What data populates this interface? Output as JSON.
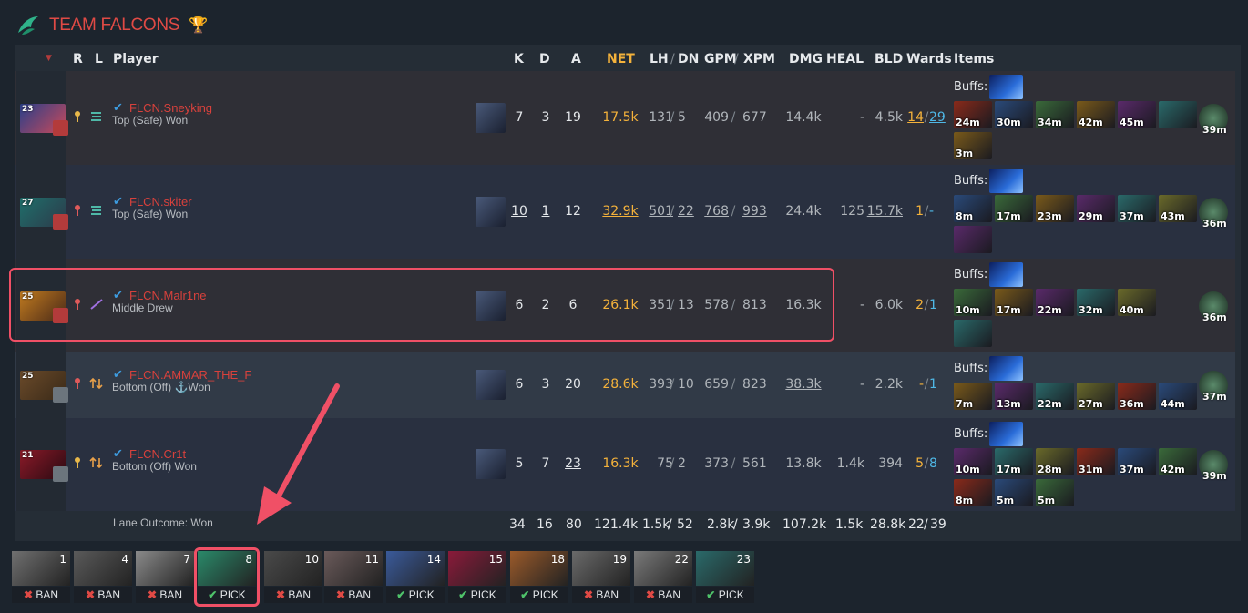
{
  "team": {
    "name": "TEAM FALCONS",
    "trophy_icon": "trophy-icon",
    "logo_icon": "falcon-logo-icon"
  },
  "columns": {
    "r": "R",
    "l": "L",
    "player": "Player",
    "k": "K",
    "d": "D",
    "a": "A",
    "net": "NET",
    "lh": "LH",
    "dn": "DN",
    "gpm": "GPM",
    "xpm": "XPM",
    "dmg": "DMG",
    "heal": "HEAL",
    "bld": "BLD",
    "wards": "Wards",
    "items": "Items",
    "sep": "/"
  },
  "buffs_label": "Buffs:",
  "players": [
    {
      "level": "23",
      "name": "FLCN.Sneyking",
      "lane": "Top (Safe) Won",
      "k": "7",
      "d": "3",
      "a": "19",
      "net": "17.5k",
      "lh": "131",
      "dn": "5",
      "gpm": "409",
      "xpm": "677",
      "dmg": "14.4k",
      "heal": "-",
      "bld": "4.5k",
      "wards_obs": "14",
      "wards_sen": "29",
      "items": [
        "24m",
        "30m",
        "34m",
        "42m",
        "45m",
        ""
      ],
      "items2": [
        "3m"
      ],
      "neutral": "39m"
    },
    {
      "level": "27",
      "name": "FLCN.skiter",
      "lane": "Top (Safe) Won",
      "k": "10",
      "d": "1",
      "a": "12",
      "net": "32.9k",
      "lh": "501",
      "dn": "22",
      "gpm": "768",
      "xpm": "993",
      "dmg": "24.4k",
      "heal": "125",
      "bld": "15.7k",
      "wards_obs": "1",
      "wards_sen": "-",
      "items": [
        "8m",
        "17m",
        "23m",
        "29m",
        "37m",
        "43m"
      ],
      "items2": [
        ""
      ],
      "neutral": "36m"
    },
    {
      "level": "25",
      "name": "FLCN.Malr1ne",
      "lane": "Middle Drew",
      "k": "6",
      "d": "2",
      "a": "6",
      "net": "26.1k",
      "lh": "351",
      "dn": "13",
      "gpm": "578",
      "xpm": "813",
      "dmg": "16.3k",
      "heal": "-",
      "bld": "6.0k",
      "wards_obs": "2",
      "wards_sen": "1",
      "items": [
        "10m",
        "17m",
        "22m",
        "32m",
        "40m"
      ],
      "items2": [
        ""
      ],
      "neutral": "36m"
    },
    {
      "level": "25",
      "name": "FLCN.AMMAR_THE_F",
      "lane": "Bottom (Off) ⚓Won",
      "k": "6",
      "d": "3",
      "a": "20",
      "net": "28.6k",
      "lh": "393",
      "dn": "10",
      "gpm": "659",
      "xpm": "823",
      "dmg": "38.3k",
      "heal": "-",
      "bld": "2.2k",
      "wards_obs": "-",
      "wards_sen": "1",
      "items": [
        "7m",
        "13m",
        "22m",
        "27m",
        "36m",
        "44m"
      ],
      "items2": [],
      "neutral": "37m"
    },
    {
      "level": "21",
      "name": "FLCN.Cr1t-",
      "lane": "Bottom (Off) Won",
      "k": "5",
      "d": "7",
      "a": "23",
      "net": "16.3k",
      "lh": "75",
      "dn": "2",
      "gpm": "373",
      "xpm": "561",
      "dmg": "13.8k",
      "heal": "1.4k",
      "bld": "394",
      "wards_obs": "5",
      "wards_sen": "8",
      "items": [
        "10m",
        "17m",
        "28m",
        "31m",
        "37m",
        "42m"
      ],
      "items2": [
        "8m",
        "5m",
        "5m"
      ],
      "neutral": "39m"
    }
  ],
  "totals": {
    "label": "Lane Outcome: Won",
    "k": "34",
    "d": "16",
    "a": "80",
    "net": "121.4k",
    "lh": "1.5k",
    "dn": "52",
    "gpm": "2.8k",
    "xpm": "3.9k",
    "dmg": "107.2k",
    "heal": "1.5k",
    "bld": "28.8k",
    "wards_obs": "22",
    "wards_sen": "39"
  },
  "draft": [
    {
      "order": "1",
      "action": "BAN"
    },
    {
      "order": "4",
      "action": "BAN"
    },
    {
      "order": "7",
      "action": "BAN"
    },
    {
      "order": "8",
      "action": "PICK"
    },
    {
      "order": "10",
      "action": "BAN"
    },
    {
      "order": "11",
      "action": "BAN"
    },
    {
      "order": "14",
      "action": "PICK"
    },
    {
      "order": "15",
      "action": "PICK"
    },
    {
      "order": "18",
      "action": "PICK"
    },
    {
      "order": "19",
      "action": "BAN"
    },
    {
      "order": "22",
      "action": "BAN"
    },
    {
      "order": "23",
      "action": "PICK"
    }
  ],
  "colors": {
    "accent_red": "#e04a45",
    "gold": "#f4b23b",
    "blue": "#4fb8e6",
    "highlight": "#f05066"
  }
}
